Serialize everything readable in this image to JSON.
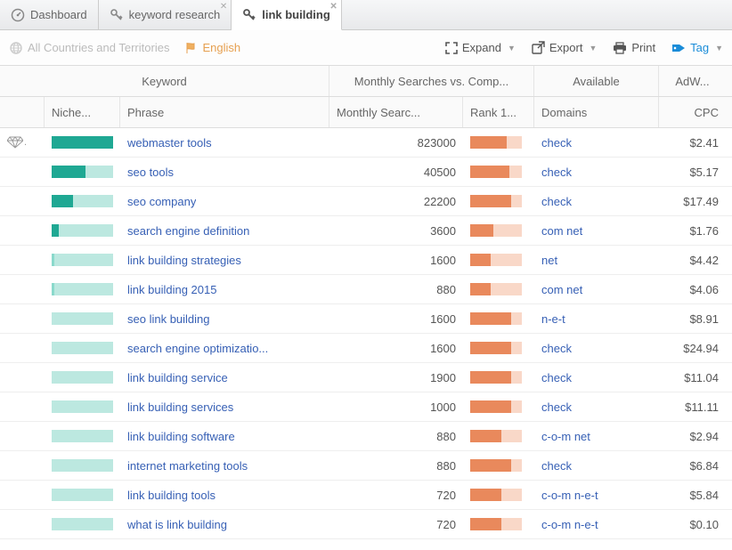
{
  "tabs": [
    {
      "label": "Dashboard",
      "icon": "dashboard",
      "closable": false
    },
    {
      "label": "keyword research",
      "icon": "key",
      "closable": true
    },
    {
      "label": "link building",
      "icon": "key",
      "closable": true,
      "active": true
    }
  ],
  "toolbar": {
    "countries": "All Countries and Territories",
    "language": "English",
    "expand": "Expand",
    "export": "Export",
    "print": "Print",
    "tag": "Tag"
  },
  "headers": {
    "keyword": "Keyword",
    "monthly_group": "Monthly Searches vs. Comp...",
    "available": "Available",
    "adw": "AdW...",
    "niche": "Niche...",
    "phrase": "Phrase",
    "monthly": "Monthly Searc...",
    "rank": "Rank 1...",
    "domains": "Domains",
    "cpc": "CPC"
  },
  "rows": [
    {
      "diamond": true,
      "niche_fill": 100,
      "niche_tone": "dark",
      "phrase": "webmaster tools",
      "searches": "823000",
      "rank": 70,
      "domains": "check",
      "cpc": "$2.41"
    },
    {
      "niche_fill": 55,
      "niche_tone": "dark",
      "phrase": "seo tools",
      "searches": "40500",
      "rank": 75,
      "domains": "check",
      "cpc": "$5.17"
    },
    {
      "niche_fill": 35,
      "niche_tone": "dark",
      "phrase": "seo company",
      "searches": "22200",
      "rank": 80,
      "domains": "check",
      "cpc": "$17.49"
    },
    {
      "niche_fill": 12,
      "niche_tone": "dark",
      "phrase": "search engine definition",
      "searches": "3600",
      "rank": 45,
      "domains": "com net",
      "cpc": "$1.76"
    },
    {
      "niche_fill": 5,
      "niche_tone": "light",
      "phrase": "link building strategies",
      "searches": "1600",
      "rank": 40,
      "domains": "net",
      "cpc": "$4.42"
    },
    {
      "niche_fill": 4,
      "niche_tone": "light",
      "phrase": "link building 2015",
      "searches": "880",
      "rank": 40,
      "domains": "com net",
      "cpc": "$4.06"
    },
    {
      "niche_fill": 0,
      "niche_tone": "light",
      "phrase": "seo link building",
      "searches": "1600",
      "rank": 80,
      "domains": "n-e-t",
      "cpc": "$8.91"
    },
    {
      "niche_fill": 0,
      "niche_tone": "light",
      "phrase": "search engine optimizatio...",
      "searches": "1600",
      "rank": 80,
      "domains": "check",
      "cpc": "$24.94"
    },
    {
      "niche_fill": 0,
      "niche_tone": "light",
      "phrase": "link building service",
      "searches": "1900",
      "rank": 80,
      "domains": "check",
      "cpc": "$11.04"
    },
    {
      "niche_fill": 0,
      "niche_tone": "light",
      "phrase": "link building services",
      "searches": "1000",
      "rank": 80,
      "domains": "check",
      "cpc": "$11.11"
    },
    {
      "niche_fill": 0,
      "niche_tone": "light",
      "phrase": "link building software",
      "searches": "880",
      "rank": 60,
      "domains": "c-o-m net",
      "cpc": "$2.94"
    },
    {
      "niche_fill": 0,
      "niche_tone": "light",
      "phrase": "internet marketing tools",
      "searches": "880",
      "rank": 80,
      "domains": "check",
      "cpc": "$6.84"
    },
    {
      "niche_fill": 0,
      "niche_tone": "light",
      "phrase": "link building tools",
      "searches": "720",
      "rank": 60,
      "domains": "c-o-m n-e-t",
      "cpc": "$5.84"
    },
    {
      "niche_fill": 0,
      "niche_tone": "light",
      "phrase": "what is link building",
      "searches": "720",
      "rank": 60,
      "domains": "c-o-m n-e-t",
      "cpc": "$0.10"
    }
  ]
}
